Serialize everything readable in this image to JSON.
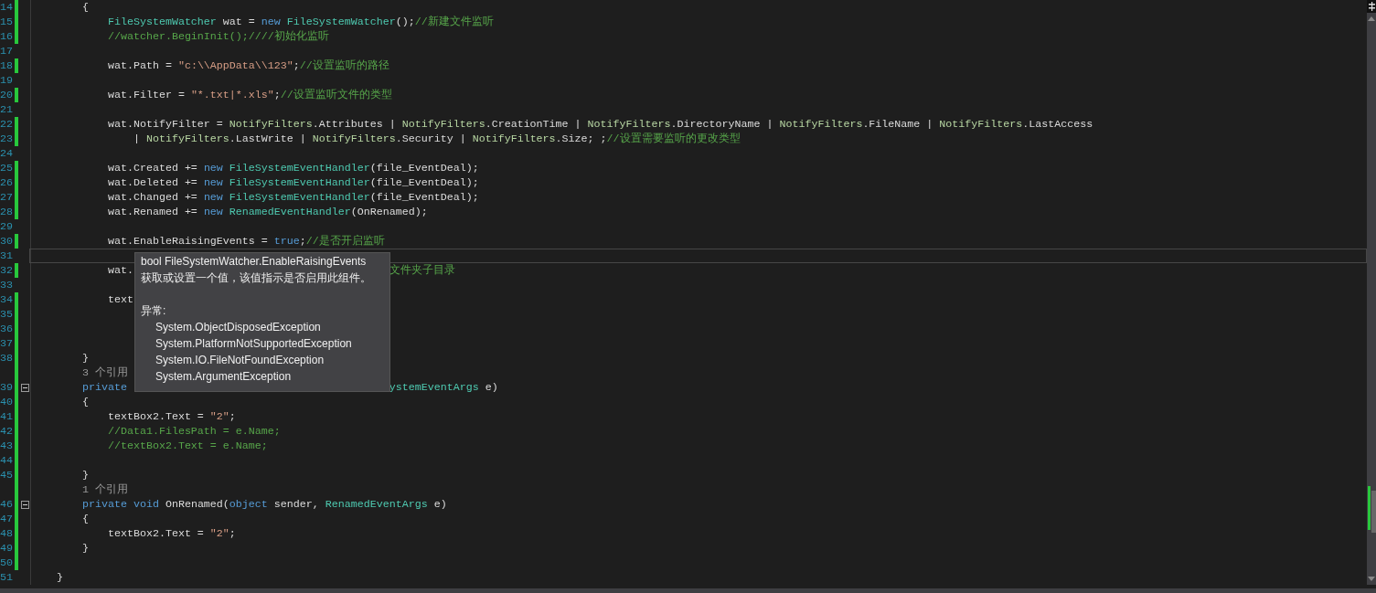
{
  "editor": {
    "lines": [
      {
        "kind": "code",
        "number": "14",
        "changed": true,
        "current": false,
        "tokens": [
          {
            "kind": "plain",
            "text": "        {"
          }
        ]
      },
      {
        "kind": "code",
        "number": "15",
        "changed": true,
        "current": false,
        "tokens": [
          {
            "kind": "type",
            "text": "            FileSystemWatcher"
          },
          {
            "kind": "plain",
            "text": " wat = "
          },
          {
            "kind": "keyword",
            "text": "new "
          },
          {
            "kind": "type",
            "text": "FileSystemWatcher"
          },
          {
            "kind": "plain",
            "text": "();"
          },
          {
            "kind": "comment",
            "text": "//新建文件监听"
          }
        ]
      },
      {
        "kind": "code",
        "number": "16",
        "changed": true,
        "current": false,
        "tokens": [
          {
            "kind": "comment",
            "text": "            //watcher.BeginInit();////初始化监听"
          }
        ]
      },
      {
        "kind": "code",
        "number": "17",
        "changed": false,
        "current": false
      },
      {
        "kind": "code",
        "number": "18",
        "changed": true,
        "current": false,
        "tokens": [
          {
            "kind": "plain",
            "text": "            wat.Path = "
          },
          {
            "kind": "string",
            "text": "\"c:\\\\AppData\\\\123\""
          },
          {
            "kind": "plain",
            "text": ";"
          },
          {
            "kind": "comment",
            "text": "//设置监听的路径"
          }
        ]
      },
      {
        "kind": "code",
        "number": "19",
        "changed": false,
        "current": false
      },
      {
        "kind": "code",
        "number": "20",
        "changed": true,
        "current": false,
        "tokens": [
          {
            "kind": "plain",
            "text": "            wat.Filter = "
          },
          {
            "kind": "string",
            "text": "\"*.txt|*.xls\""
          },
          {
            "kind": "plain",
            "text": ";"
          },
          {
            "kind": "comment",
            "text": "//设置监听文件的类型"
          }
        ]
      },
      {
        "kind": "code",
        "number": "21",
        "changed": false,
        "current": false
      },
      {
        "kind": "code",
        "number": "22",
        "changed": true,
        "current": false,
        "tokens": [
          {
            "kind": "plain",
            "text": "            wat.NotifyFilter = "
          },
          {
            "kind": "enum",
            "text": "NotifyFilters"
          },
          {
            "kind": "plain",
            "text": ".Attributes | "
          },
          {
            "kind": "enum",
            "text": "NotifyFilters"
          },
          {
            "kind": "plain",
            "text": ".CreationTime | "
          },
          {
            "kind": "enum",
            "text": "NotifyFilters"
          },
          {
            "kind": "plain",
            "text": ".DirectoryName | "
          },
          {
            "kind": "enum",
            "text": "NotifyFilters"
          },
          {
            "kind": "plain",
            "text": ".FileName | "
          },
          {
            "kind": "enum",
            "text": "NotifyFilters"
          },
          {
            "kind": "plain",
            "text": ".LastAccess"
          }
        ]
      },
      {
        "kind": "code",
        "number": "23",
        "changed": true,
        "current": false,
        "tokens": [
          {
            "kind": "plain",
            "text": "                | "
          },
          {
            "kind": "enum",
            "text": "NotifyFilters"
          },
          {
            "kind": "plain",
            "text": ".LastWrite | "
          },
          {
            "kind": "enum",
            "text": "NotifyFilters"
          },
          {
            "kind": "plain",
            "text": ".Security | "
          },
          {
            "kind": "enum",
            "text": "NotifyFilters"
          },
          {
            "kind": "plain",
            "text": ".Size; ;"
          },
          {
            "kind": "comment",
            "text": "//设置需要监听的更改类型"
          }
        ]
      },
      {
        "kind": "code",
        "number": "24",
        "changed": false,
        "current": false
      },
      {
        "kind": "code",
        "number": "25",
        "changed": true,
        "current": false,
        "tokens": [
          {
            "kind": "plain",
            "text": "            wat.Created += "
          },
          {
            "kind": "keyword",
            "text": "new "
          },
          {
            "kind": "type",
            "text": "FileSystemEventHandler"
          },
          {
            "kind": "plain",
            "text": "(file_EventDeal);"
          }
        ]
      },
      {
        "kind": "code",
        "number": "26",
        "changed": true,
        "current": false,
        "tokens": [
          {
            "kind": "plain",
            "text": "            wat.Deleted += "
          },
          {
            "kind": "keyword",
            "text": "new "
          },
          {
            "kind": "type",
            "text": "FileSystemEventHandler"
          },
          {
            "kind": "plain",
            "text": "(file_EventDeal);"
          }
        ]
      },
      {
        "kind": "code",
        "number": "27",
        "changed": true,
        "current": false,
        "tokens": [
          {
            "kind": "plain",
            "text": "            wat.Changed += "
          },
          {
            "kind": "keyword",
            "text": "new "
          },
          {
            "kind": "type",
            "text": "FileSystemEventHandler"
          },
          {
            "kind": "plain",
            "text": "(file_EventDeal);"
          }
        ]
      },
      {
        "kind": "code",
        "number": "28",
        "changed": true,
        "current": false,
        "tokens": [
          {
            "kind": "plain",
            "text": "            wat.Renamed += "
          },
          {
            "kind": "keyword",
            "text": "new "
          },
          {
            "kind": "type",
            "text": "RenamedEventHandler"
          },
          {
            "kind": "plain",
            "text": "(OnRenamed);"
          }
        ]
      },
      {
        "kind": "code",
        "number": "29",
        "changed": false,
        "current": false
      },
      {
        "kind": "code",
        "number": "30",
        "changed": true,
        "current": false,
        "tokens": [
          {
            "kind": "plain",
            "text": "            wat.EnableRaisingEvents = "
          },
          {
            "kind": "keyword",
            "text": "true"
          },
          {
            "kind": "plain",
            "text": ";"
          },
          {
            "kind": "comment",
            "text": "//是否开启监听"
          }
        ]
      },
      {
        "kind": "code",
        "number": "31",
        "changed": false,
        "current": true
      },
      {
        "kind": "code",
        "number": "32",
        "changed": true,
        "current": false,
        "tokens": [
          {
            "kind": "plain",
            "text": "            wat."
          }
        ],
        "tokens_right": [
          {
            "kind": "comment",
            "text": "文件夹子目录"
          }
        ]
      },
      {
        "kind": "code",
        "number": "33",
        "changed": false,
        "current": false
      },
      {
        "kind": "code",
        "number": "34",
        "changed": true,
        "current": false,
        "tokens": [
          {
            "kind": "plain",
            "text": "            text"
          }
        ]
      },
      {
        "kind": "code",
        "number": "35",
        "changed": true,
        "current": false
      },
      {
        "kind": "code",
        "number": "36",
        "changed": true,
        "current": false
      },
      {
        "kind": "code",
        "number": "37",
        "changed": true,
        "current": false
      },
      {
        "kind": "code",
        "number": "38",
        "changed": true,
        "current": false,
        "tokens": [
          {
            "kind": "plain",
            "text": "        }"
          }
        ]
      },
      {
        "kind": "codelens",
        "changed": true,
        "text": "3 个引用"
      },
      {
        "kind": "code",
        "number": "39",
        "changed": true,
        "current": false,
        "fold": {
          "expanded": true
        },
        "tokens": [
          {
            "kind": "keyword",
            "text": "        private"
          }
        ],
        "tokens_right": [
          {
            "kind": "type",
            "text": "ystemEventArgs"
          },
          {
            "kind": "plain",
            "text": " e)"
          }
        ]
      },
      {
        "kind": "code",
        "number": "40",
        "changed": true,
        "current": false,
        "tokens": [
          {
            "kind": "plain",
            "text": "        {"
          }
        ]
      },
      {
        "kind": "code",
        "number": "41",
        "changed": true,
        "current": false,
        "tokens": [
          {
            "kind": "plain",
            "text": "            textBox2.Text = "
          },
          {
            "kind": "string",
            "text": "\"2\""
          },
          {
            "kind": "plain",
            "text": ";"
          }
        ]
      },
      {
        "kind": "code",
        "number": "42",
        "changed": true,
        "current": false,
        "tokens": [
          {
            "kind": "comment",
            "text": "            //Data1.FilesPath = e.Name;"
          }
        ]
      },
      {
        "kind": "code",
        "number": "43",
        "changed": true,
        "current": false,
        "tokens": [
          {
            "kind": "comment",
            "text": "            //textBox2.Text = e.Name;"
          }
        ]
      },
      {
        "kind": "code",
        "number": "44",
        "changed": true,
        "current": false
      },
      {
        "kind": "code",
        "number": "45",
        "changed": true,
        "current": false,
        "tokens": [
          {
            "kind": "plain",
            "text": "        }"
          }
        ]
      },
      {
        "kind": "codelens",
        "changed": true,
        "text": "1 个引用"
      },
      {
        "kind": "code",
        "number": "46",
        "changed": true,
        "current": false,
        "fold": {
          "expanded": true
        },
        "tokens": [
          {
            "kind": "keyword",
            "text": "        private void"
          },
          {
            "kind": "plain",
            "text": " OnRenamed("
          },
          {
            "kind": "keyword",
            "text": "object"
          },
          {
            "kind": "plain",
            "text": " sender, "
          },
          {
            "kind": "type",
            "text": "RenamedEventArgs"
          },
          {
            "kind": "plain",
            "text": " e)"
          }
        ]
      },
      {
        "kind": "code",
        "number": "47",
        "changed": true,
        "current": false,
        "tokens": [
          {
            "kind": "plain",
            "text": "        {"
          }
        ]
      },
      {
        "kind": "code",
        "number": "48",
        "changed": true,
        "current": false,
        "tokens": [
          {
            "kind": "plain",
            "text": "            textBox2.Text = "
          },
          {
            "kind": "string",
            "text": "\"2\""
          },
          {
            "kind": "plain",
            "text": ";"
          }
        ]
      },
      {
        "kind": "code",
        "number": "49",
        "changed": true,
        "current": false,
        "tokens": [
          {
            "kind": "plain",
            "text": "        }"
          }
        ]
      },
      {
        "kind": "code",
        "number": "50",
        "changed": true,
        "current": false
      },
      {
        "kind": "code",
        "number": "51",
        "changed": false,
        "current": false,
        "tokens": [
          {
            "kind": "plain",
            "text": "    }"
          }
        ]
      }
    ]
  },
  "tooltip": {
    "signature": "bool FileSystemWatcher.EnableRaisingEvents",
    "description": "获取或设置一个值，该值指示是否启用此组件。",
    "exceptions_heading": "异常:",
    "exceptions": [
      "System.ObjectDisposedException",
      "System.PlatformNotSupportedException",
      "System.IO.FileNotFoundException",
      "System.ArgumentException"
    ]
  }
}
